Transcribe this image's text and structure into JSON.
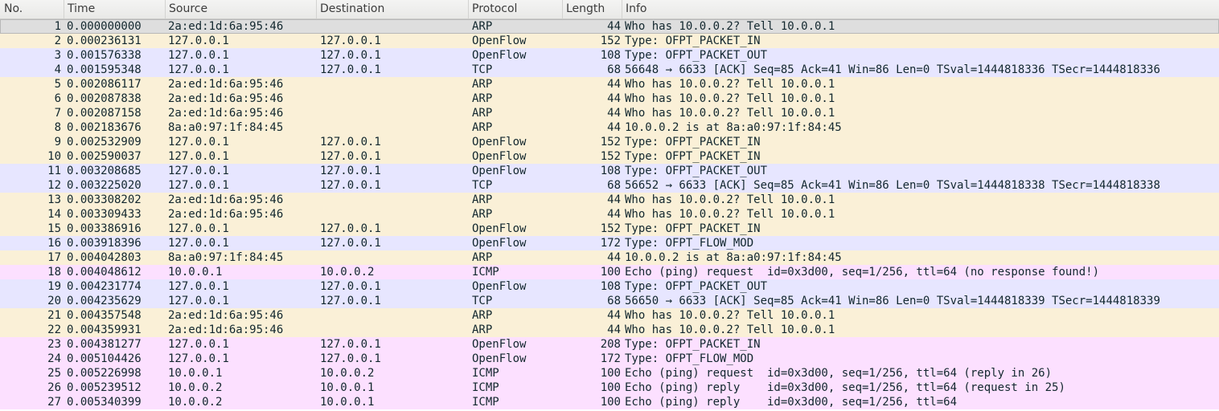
{
  "colors": {
    "ARP": "#faf0d7",
    "OpenFlow": "#faf0d7",
    "TCP": "#e7e6ff",
    "ICMP": "#fce0ff",
    "selected": "#dedede"
  },
  "columns": [
    {
      "key": "no",
      "label": "No."
    },
    {
      "key": "time",
      "label": "Time"
    },
    {
      "key": "source",
      "label": "Source"
    },
    {
      "key": "destination",
      "label": "Destination"
    },
    {
      "key": "protocol",
      "label": "Protocol"
    },
    {
      "key": "length",
      "label": "Length"
    },
    {
      "key": "info",
      "label": "Info"
    }
  ],
  "packets": [
    {
      "no": "1",
      "time": "0.000000000",
      "source": "2a:ed:1d:6a:95:46",
      "destination": "",
      "protocol": "ARP",
      "length": "44",
      "info": "Who has 10.0.0.2? Tell 10.0.0.1",
      "color": "#dedede",
      "selected": true
    },
    {
      "no": "2",
      "time": "0.000236131",
      "source": "127.0.0.1",
      "destination": "127.0.0.1",
      "protocol": "OpenFlow",
      "length": "152",
      "info": "Type: OFPT_PACKET_IN",
      "color": "#faf0d7"
    },
    {
      "no": "3",
      "time": "0.001576338",
      "source": "127.0.0.1",
      "destination": "127.0.0.1",
      "protocol": "OpenFlow",
      "length": "108",
      "info": "Type: OFPT_PACKET_OUT",
      "color": "#e7e6ff"
    },
    {
      "no": "4",
      "time": "0.001595348",
      "source": "127.0.0.1",
      "destination": "127.0.0.1",
      "protocol": "TCP",
      "length": "68",
      "info": "56648 → 6633 [ACK] Seq=85 Ack=41 Win=86 Len=0 TSval=1444818336 TSecr=1444818336",
      "color": "#e7e6ff"
    },
    {
      "no": "5",
      "time": "0.002086117",
      "source": "2a:ed:1d:6a:95:46",
      "destination": "",
      "protocol": "ARP",
      "length": "44",
      "info": "Who has 10.0.0.2? Tell 10.0.0.1",
      "color": "#faf0d7"
    },
    {
      "no": "6",
      "time": "0.002087838",
      "source": "2a:ed:1d:6a:95:46",
      "destination": "",
      "protocol": "ARP",
      "length": "44",
      "info": "Who has 10.0.0.2? Tell 10.0.0.1",
      "color": "#faf0d7"
    },
    {
      "no": "7",
      "time": "0.002087158",
      "source": "2a:ed:1d:6a:95:46",
      "destination": "",
      "protocol": "ARP",
      "length": "44",
      "info": "Who has 10.0.0.2? Tell 10.0.0.1",
      "color": "#faf0d7"
    },
    {
      "no": "8",
      "time": "0.002183676",
      "source": "8a:a0:97:1f:84:45",
      "destination": "",
      "protocol": "ARP",
      "length": "44",
      "info": "10.0.0.2 is at 8a:a0:97:1f:84:45",
      "color": "#faf0d7"
    },
    {
      "no": "9",
      "time": "0.002532909",
      "source": "127.0.0.1",
      "destination": "127.0.0.1",
      "protocol": "OpenFlow",
      "length": "152",
      "info": "Type: OFPT_PACKET_IN",
      "color": "#faf0d7"
    },
    {
      "no": "10",
      "time": "0.002590037",
      "source": "127.0.0.1",
      "destination": "127.0.0.1",
      "protocol": "OpenFlow",
      "length": "152",
      "info": "Type: OFPT_PACKET_IN",
      "color": "#faf0d7"
    },
    {
      "no": "11",
      "time": "0.003208685",
      "source": "127.0.0.1",
      "destination": "127.0.0.1",
      "protocol": "OpenFlow",
      "length": "108",
      "info": "Type: OFPT_PACKET_OUT",
      "color": "#e7e6ff"
    },
    {
      "no": "12",
      "time": "0.003225020",
      "source": "127.0.0.1",
      "destination": "127.0.0.1",
      "protocol": "TCP",
      "length": "68",
      "info": "56652 → 6633 [ACK] Seq=85 Ack=41 Win=86 Len=0 TSval=1444818338 TSecr=1444818338",
      "color": "#e7e6ff"
    },
    {
      "no": "13",
      "time": "0.003308202",
      "source": "2a:ed:1d:6a:95:46",
      "destination": "",
      "protocol": "ARP",
      "length": "44",
      "info": "Who has 10.0.0.2? Tell 10.0.0.1",
      "color": "#faf0d7"
    },
    {
      "no": "14",
      "time": "0.003309433",
      "source": "2a:ed:1d:6a:95:46",
      "destination": "",
      "protocol": "ARP",
      "length": "44",
      "info": "Who has 10.0.0.2? Tell 10.0.0.1",
      "color": "#faf0d7"
    },
    {
      "no": "15",
      "time": "0.003386916",
      "source": "127.0.0.1",
      "destination": "127.0.0.1",
      "protocol": "OpenFlow",
      "length": "152",
      "info": "Type: OFPT_PACKET_IN",
      "color": "#faf0d7"
    },
    {
      "no": "16",
      "time": "0.003918396",
      "source": "127.0.0.1",
      "destination": "127.0.0.1",
      "protocol": "OpenFlow",
      "length": "172",
      "info": "Type: OFPT_FLOW_MOD",
      "color": "#e7e6ff"
    },
    {
      "no": "17",
      "time": "0.004042803",
      "source": "8a:a0:97:1f:84:45",
      "destination": "",
      "protocol": "ARP",
      "length": "44",
      "info": "10.0.0.2 is at 8a:a0:97:1f:84:45",
      "color": "#faf0d7"
    },
    {
      "no": "18",
      "time": "0.004048612",
      "source": "10.0.0.1",
      "destination": "10.0.0.2",
      "protocol": "ICMP",
      "length": "100",
      "info": "Echo (ping) request  id=0x3d00, seq=1/256, ttl=64 (no response found!)",
      "color": "#fce0ff"
    },
    {
      "no": "19",
      "time": "0.004231774",
      "source": "127.0.0.1",
      "destination": "127.0.0.1",
      "protocol": "OpenFlow",
      "length": "108",
      "info": "Type: OFPT_PACKET_OUT",
      "color": "#e7e6ff"
    },
    {
      "no": "20",
      "time": "0.004235629",
      "source": "127.0.0.1",
      "destination": "127.0.0.1",
      "protocol": "TCP",
      "length": "68",
      "info": "56650 → 6633 [ACK] Seq=85 Ack=41 Win=86 Len=0 TSval=1444818339 TSecr=1444818339",
      "color": "#e7e6ff"
    },
    {
      "no": "21",
      "time": "0.004357548",
      "source": "2a:ed:1d:6a:95:46",
      "destination": "",
      "protocol": "ARP",
      "length": "44",
      "info": "Who has 10.0.0.2? Tell 10.0.0.1",
      "color": "#faf0d7"
    },
    {
      "no": "22",
      "time": "0.004359931",
      "source": "2a:ed:1d:6a:95:46",
      "destination": "",
      "protocol": "ARP",
      "length": "44",
      "info": "Who has 10.0.0.2? Tell 10.0.0.1",
      "color": "#faf0d7"
    },
    {
      "no": "23",
      "time": "0.004381277",
      "source": "127.0.0.1",
      "destination": "127.0.0.1",
      "protocol": "OpenFlow",
      "length": "208",
      "info": "Type: OFPT_PACKET_IN",
      "color": "#fce0ff"
    },
    {
      "no": "24",
      "time": "0.005104426",
      "source": "127.0.0.1",
      "destination": "127.0.0.1",
      "protocol": "OpenFlow",
      "length": "172",
      "info": "Type: OFPT_FLOW_MOD",
      "color": "#fce0ff"
    },
    {
      "no": "25",
      "time": "0.005226998",
      "source": "10.0.0.1",
      "destination": "10.0.0.2",
      "protocol": "ICMP",
      "length": "100",
      "info": "Echo (ping) request  id=0x3d00, seq=1/256, ttl=64 (reply in 26)",
      "color": "#fce0ff"
    },
    {
      "no": "26",
      "time": "0.005239512",
      "source": "10.0.0.2",
      "destination": "10.0.0.1",
      "protocol": "ICMP",
      "length": "100",
      "info": "Echo (ping) reply    id=0x3d00, seq=1/256, ttl=64 (request in 25)",
      "color": "#fce0ff"
    },
    {
      "no": "27",
      "time": "0.005340399",
      "source": "10.0.0.2",
      "destination": "10.0.0.1",
      "protocol": "ICMP",
      "length": "100",
      "info": "Echo (ping) reply    id=0x3d00, seq=1/256, ttl=64",
      "color": "#fce0ff"
    }
  ]
}
